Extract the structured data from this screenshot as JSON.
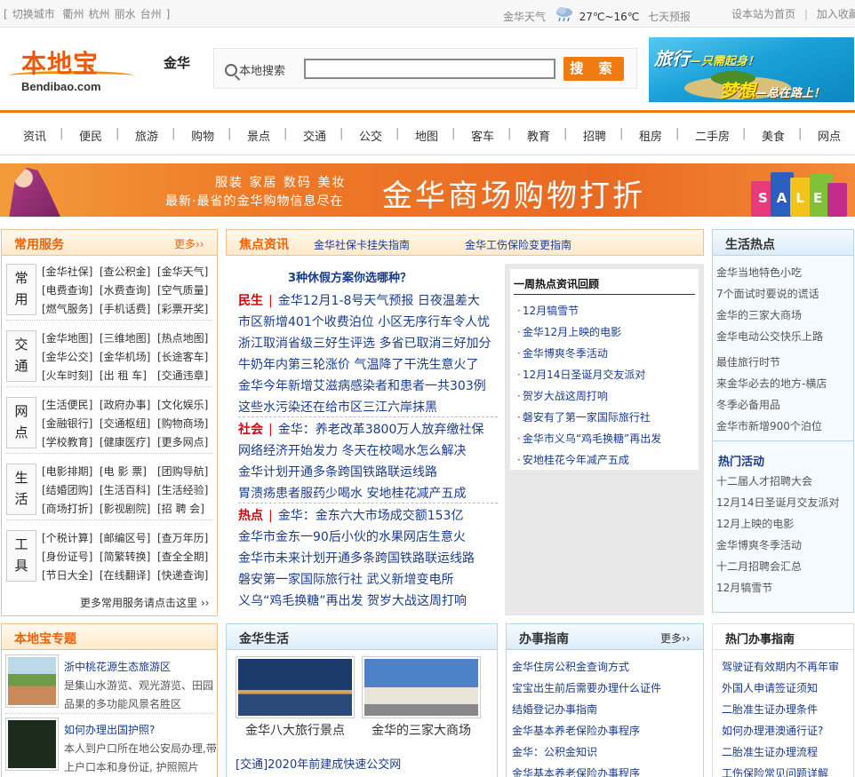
{
  "topbar": {
    "switch_prefix": "[",
    "switch_label": "切换城市",
    "cities": [
      "衢州",
      "杭州",
      "丽水",
      "台州"
    ],
    "switch_suffix": "]",
    "weather_city": "金华天气",
    "temp": "27℃~16℃",
    "forecast": "七天预报",
    "set_home": "设本站为首页",
    "divider": "|",
    "favorite": "加入收藏"
  },
  "header": {
    "logo_cn": "本地宝",
    "logo_en": "Bendibao.com",
    "city": "金华",
    "search_label": "本地搜索",
    "search_value": "",
    "search_button": "搜 索",
    "ad_line1": "旅行",
    "ad_line1b": "—只需起身！",
    "ad_line2": "梦想",
    "ad_line2b": "—总在路上！"
  },
  "nav": [
    "资讯",
    "便民",
    "旅游",
    "购物",
    "景点",
    "交通",
    "公交",
    "地图",
    "客车",
    "教育",
    "招聘",
    "租房",
    "二手房",
    "美食",
    "网点"
  ],
  "nav_sep": "|",
  "banner": {
    "line1": "服装 家居 数码 美妆",
    "line2": "最新·最省的金华购物信息尽在",
    "big": "金华商场购物打折",
    "sale": "SALE"
  },
  "services": {
    "title": "常用服务",
    "more": "更多››",
    "groups": [
      {
        "cat": [
          "常",
          "用"
        ],
        "links": [
          "[金华社保]",
          "[查公积金]",
          "[金华天气]",
          "[电费查询]",
          "[水费查询]",
          "[空气质量]",
          "[燃气服务]",
          "[手机话费]",
          "[彩票开奖]"
        ]
      },
      {
        "cat": [
          "交",
          "通"
        ],
        "links": [
          "[金华地图]",
          "[三维地图]",
          "[热点地图]",
          "[金华公交]",
          "[金华机场]",
          "[长途客车]",
          "[火车时刻]",
          "[出 租 车]",
          "[交通违章]"
        ]
      },
      {
        "cat": [
          "网",
          "点"
        ],
        "links": [
          "[生活便民]",
          "[政府办事]",
          "[文化娱乐]",
          "[金融银行]",
          "[交通枢纽]",
          "[购物商场]",
          "[学校教育]",
          "[健康医疗]",
          "[更多网点]"
        ]
      },
      {
        "cat": [
          "生",
          "活"
        ],
        "links": [
          "[电影排期]",
          "[电 影 票]",
          "[团购导航]",
          "[结婚团购]",
          "[生活百科]",
          "[生活经验]",
          "[商场打折]",
          "[影视剧院]",
          "[招 聘 会]"
        ]
      },
      {
        "cat": [
          "工",
          "具"
        ],
        "links": [
          "[个税计算]",
          "[邮编区号]",
          "[查万年历]",
          "[身份证号]",
          "[简繁转换]",
          "[查全全期]",
          "[节日大全]",
          "[在线翻译]",
          "[快递查询]"
        ]
      }
    ],
    "footer": "更多常用服务请点击这里 ››"
  },
  "news": {
    "title": "焦点资讯",
    "top_links": [
      "金华社保卡挂失指南",
      "金华工伤保险变更指南"
    ],
    "headline": "3种休假方案你选哪种？",
    "sections": [
      {
        "tag": "民生",
        "lines": [
          [
            "金华12月1-8号天气预报",
            "日夜温差大"
          ],
          [
            "市区新增401个收费泊位",
            "小区无序行车令人忧"
          ],
          [
            "浙江取消省级三好生评选",
            "多省已取消三好加分"
          ],
          [
            "牛奶年内第三轮涨价",
            "气温降了干洗生意火了"
          ],
          [
            "金华今年新增艾滋病感染者和患者一共303例"
          ],
          [
            "这些水污染还在给市区三江六岸抹黑"
          ]
        ]
      },
      {
        "tag": "社会",
        "lines": [
          [
            "金华：养老改革3800万人放弃缴社保"
          ],
          [
            "网络经济开始发力",
            "冬天在校喝水怎么解决"
          ],
          [
            "金华计划开通多条跨国铁路联运线路"
          ],
          [
            "胃溃疡患者服药少喝水",
            "安地桂花减产五成"
          ]
        ]
      },
      {
        "tag": "热点",
        "lines": [
          [
            "金华：金东六大市场成交额153亿"
          ],
          [
            "金华市金东一90后小伙的水果网店生意火"
          ],
          [
            "金华市未来计划开通多条跨国铁路联运线路"
          ],
          [
            "磐安第一家国际旅行社",
            "武义新增变电所"
          ],
          [
            "义乌“鸡毛换糖”再出发",
            "贺岁大战这周打响"
          ]
        ]
      }
    ],
    "tag_bar": "|"
  },
  "hotweek": {
    "title": "一周热点资讯回顾",
    "items": [
      "12月犒雪节",
      "金华12月上映的电影",
      "金华博爽冬季活动",
      "12月14日圣诞月交友派对",
      "贺岁大战这周打响",
      "磐安有了第一家国际旅行社",
      "金华市义乌“鸡毛换糖”再出发",
      "安地桂花今年减产五成"
    ]
  },
  "lifehot": {
    "title": "生活热点",
    "items": [
      "金华当地特色小吃",
      "7个面试时要说的谎话",
      "金华的三家大商场",
      "金华电动公交快乐上路",
      "最佳旅行时节",
      "来金华必去的地方-横店",
      "冬季必备用品",
      "金华市新增900个泊位"
    ],
    "sub_title": "热门活动",
    "events": [
      "十二届人才招聘大会",
      "12月14日圣诞月交友派对",
      "12月上映的电影",
      "金华博爽冬季活动",
      "十二月招聘会汇总",
      "12月犒雪节"
    ]
  },
  "topics": {
    "title": "本地宝专题",
    "items": [
      {
        "title": "浙中桃花源生态旅游区",
        "desc": "是集山水游览、观光游览、田园品果的多功能风景名胜区"
      },
      {
        "title": "如何办理出国护照?",
        "desc": "本人到户口所在地公安局办理,带上户口本和身份证, 护照照片"
      }
    ]
  },
  "jhlife": {
    "title": "金华生活",
    "pics": [
      "金华八大旅行景点",
      "金华的三家大商场"
    ],
    "link": "[交通]2020年前建成快速公交网"
  },
  "guide": {
    "title": "办事指南",
    "more": "更多››",
    "items": [
      "金华住房公积金查询方式",
      "宝宝出生前后需要办理什么证件",
      "结婚登记办事指南",
      "金华基本养老保险办事程序",
      "金华：公积金知识",
      "金华基本养老保险办事程序"
    ]
  },
  "hotguide": {
    "title": "热门办事指南",
    "items": [
      "驾驶证有效期内不再年审",
      "外国人申请签证须知",
      "二胎准生证办理条件",
      "如何办理港澳通行证?",
      "二胎准生证办理流程",
      "工伤保险常见问题详解"
    ]
  }
}
